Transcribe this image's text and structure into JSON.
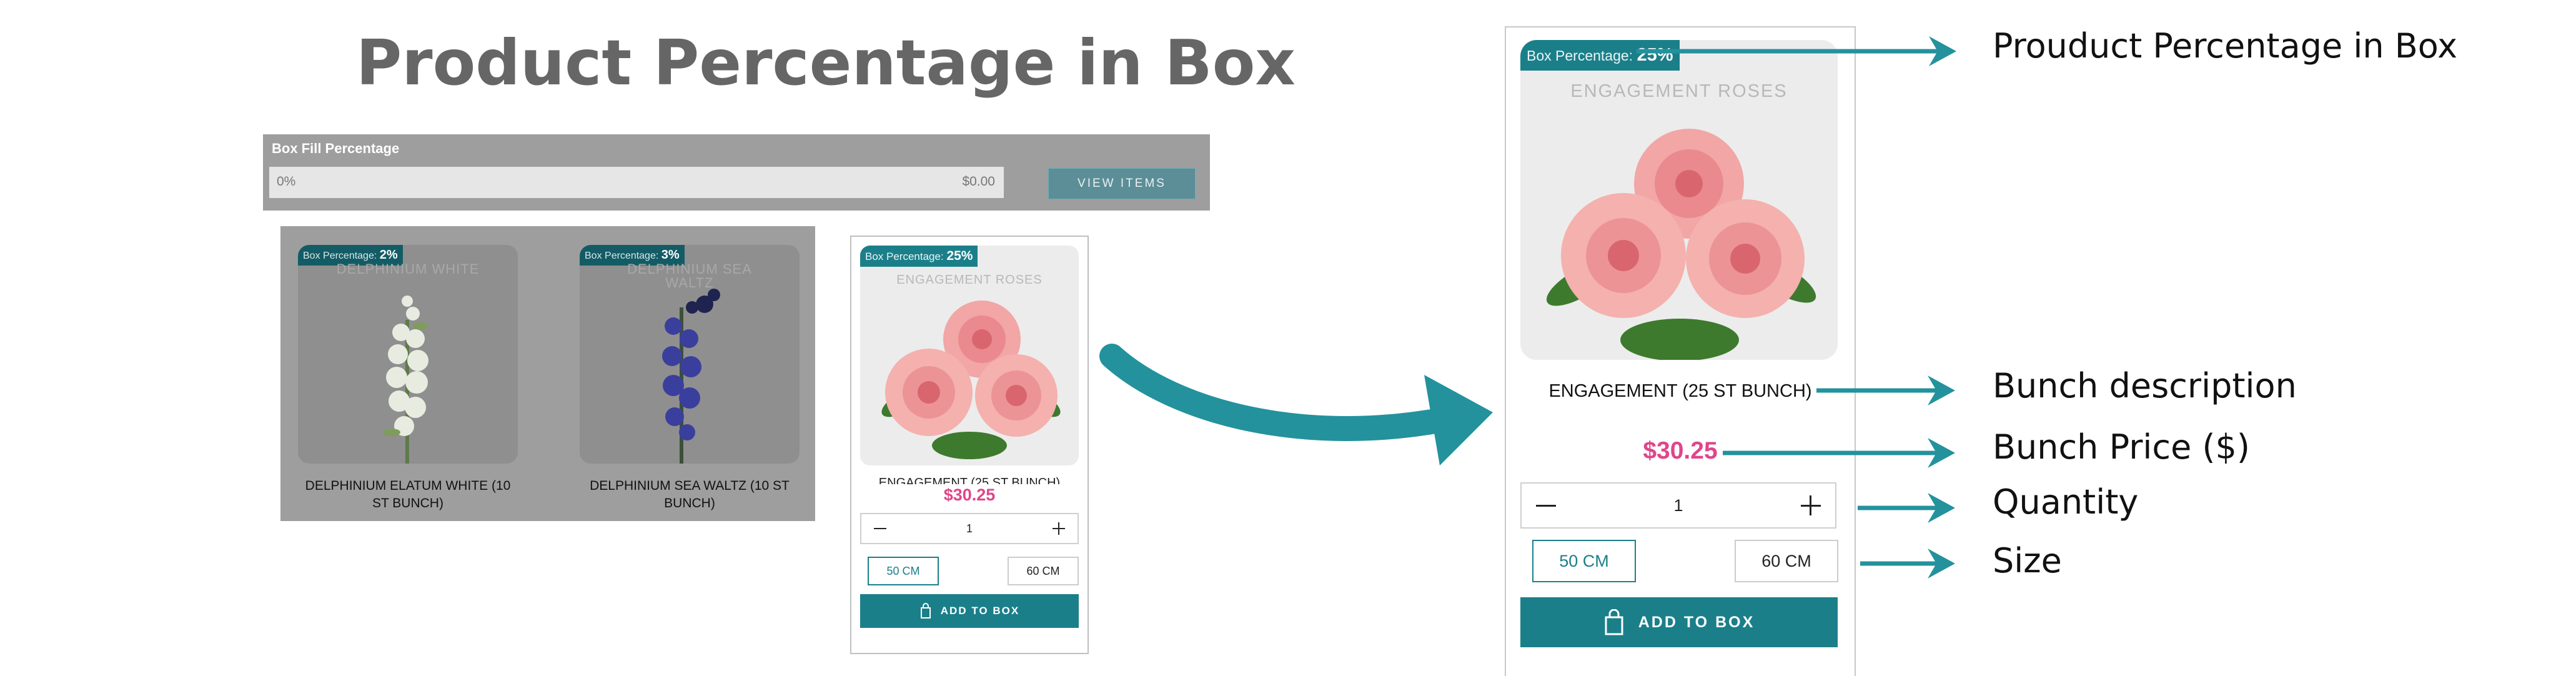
{
  "title": "Product Percentage in Box",
  "fill_bar": {
    "label": "Box Fill Percentage",
    "percent_text": "0%",
    "percent": 0,
    "amount": "$0.00",
    "view_button": "VIEW ITEMS"
  },
  "grid_products": [
    {
      "badge_prefix": "Box Percentage:",
      "badge_value": "2%",
      "image_caption": "DELPHINIUM WHITE",
      "name": "DELPHINIUM ELATUM WHITE (10 ST BUNCH)"
    },
    {
      "badge_prefix": "Box Percentage:",
      "badge_value": "3%",
      "image_caption": "DELPHINIUM SEA WALTZ",
      "name": "DELPHINIUM SEA WALTZ (10 ST BUNCH)"
    }
  ],
  "mini_card": {
    "badge_prefix": "Box Percentage:",
    "badge_value": "25%",
    "image_caption": "ENGAGEMENT ROSES",
    "name": "ENGAGEMENT (25 ST BUNCH)",
    "price": "$30.25",
    "quantity": "1",
    "sizes": [
      "50 CM",
      "60 CM"
    ],
    "selected_size": "50 CM",
    "add_button": "ADD TO BOX"
  },
  "big_card": {
    "badge_prefix": "Box Percentage:",
    "badge_value": "25%",
    "image_caption": "ENGAGEMENT ROSES",
    "name": "ENGAGEMENT (25 ST BUNCH)",
    "price": "$30.25",
    "quantity": "1",
    "sizes": [
      "50 CM",
      "60 CM"
    ],
    "selected_size": "50 CM",
    "add_button": "ADD TO BOX"
  },
  "annotations": {
    "percentage": "Prouduct Percentage in Box",
    "description": "Bunch description",
    "price": "Bunch Price ($)",
    "quantity": "Quantity",
    "size": "Size"
  },
  "colors": {
    "teal": "#1b7f8a",
    "arrow_teal": "#23929d",
    "price_pink": "#e0458a",
    "overlay_gray": "#9e9e9e"
  },
  "icons": [
    "minus-icon",
    "plus-icon",
    "shopping-bag-icon",
    "arrow-right-icon",
    "curved-arrow-icon"
  ]
}
